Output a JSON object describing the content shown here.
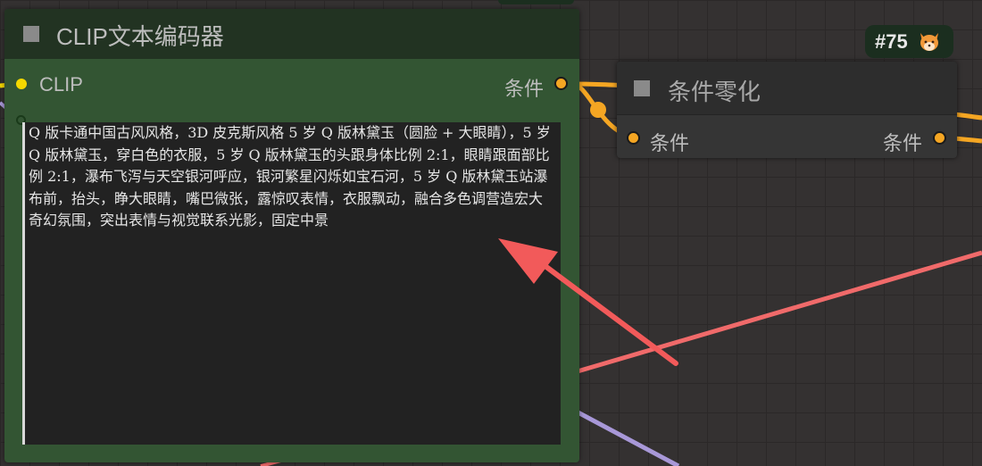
{
  "clip_node": {
    "title": "CLIP文本编码器",
    "input_label": "CLIP",
    "output_label": "条件",
    "text_value": "Q 版卡通中国古风风格，3D 皮克斯风格 5 岁 Q 版林黛玉（圆脸 + 大眼睛），5 岁 Q 版林黛玉，穿白色的衣服，5 岁 Q 版林黛玉的头跟身体比例 2:1，眼睛跟面部比例 2:1，瀑布飞泻与天空银河呼应，银河繁星闪烁如宝石河，5 岁 Q 版林黛玉站瀑布前，抬头，睁大眼睛，嘴巴微张，露惊叹表情，衣服飘动，融合多色调营造宏大奇幻氛围，突出表情与视觉联系光影，固定中景"
  },
  "zero_node": {
    "title": "条件零化",
    "input_label": "条件",
    "output_label": "条件"
  },
  "badge": {
    "label": "#75",
    "icon": "fox-icon"
  },
  "colors": {
    "wire_conditioning": "#f5a623",
    "wire_red": "#f06a6a",
    "wire_purple": "#a898d8",
    "wire_yellow": "#f5d800",
    "arrow": "#f25a5a",
    "node_green": "#335533"
  }
}
